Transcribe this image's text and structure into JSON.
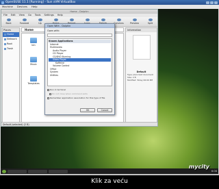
{
  "vbox": {
    "title": "OpenSUSE 11.1 [Running] - Sun xVM VirtualBox",
    "menu": [
      "Machine",
      "Devices",
      "Help"
    ]
  },
  "dolphin": {
    "title": "Home - Dolphin",
    "menu": [
      "File",
      "Edit",
      "View",
      "Go",
      "Tools",
      "Settings",
      "Help"
    ],
    "toolbar": [
      "Back",
      "Forward",
      "Up",
      "Home",
      "Reload",
      "Icons",
      "Details",
      "Columns",
      "Preview",
      "Split"
    ],
    "places_header": "Places",
    "places": [
      "Home",
      "Network",
      "Root",
      "Trash"
    ],
    "breadcrumb": "Home",
    "folders": [
      "bin",
      "Music",
      "Templates",
      "Documents",
      "Pictures",
      "public_html"
    ],
    "info_header": "Information",
    "info_name": "Default",
    "info_rows": [
      "Type: plain text document",
      "Size: 2 B",
      "Modified: Today 06:00 PM"
    ],
    "status": "Default (selected) (2 B)"
  },
  "openwith": {
    "title": "Open With - Dolphin",
    "prompt": "Open with:",
    "tree_header": "Known Applications",
    "tree": [
      {
        "label": "Internet",
        "indent": 0,
        "sel": false
      },
      {
        "label": "Multimedia",
        "indent": 0,
        "sel": false
      },
      {
        "label": "Audio Player",
        "indent": 1,
        "sel": false
      },
      {
        "label": "CD Player",
        "indent": 1,
        "sel": false
      },
      {
        "label": "CD/DVD Burning",
        "indent": 1,
        "sel": false
      },
      {
        "label": "Video Player",
        "indent": 1,
        "sel": true
      },
      {
        "label": "Kaffeine",
        "indent": 2,
        "sel": false
      },
      {
        "label": "Volume Control",
        "indent": 1,
        "sel": false
      },
      {
        "label": "Office",
        "indent": 0,
        "sel": false
      },
      {
        "label": "System",
        "indent": 0,
        "sel": false
      },
      {
        "label": "Utilities",
        "indent": 0,
        "sel": false
      }
    ],
    "opt_terminal": "Run in terminal",
    "opt_noclose": "Do not close when command exits",
    "opt_remember": "Remember application association for this type of file",
    "ok_label": "OK",
    "cancel_label": "Cancel"
  },
  "panel": {
    "clock": "6:06"
  },
  "watermark": "mycity",
  "caption": "Klik za veću"
}
